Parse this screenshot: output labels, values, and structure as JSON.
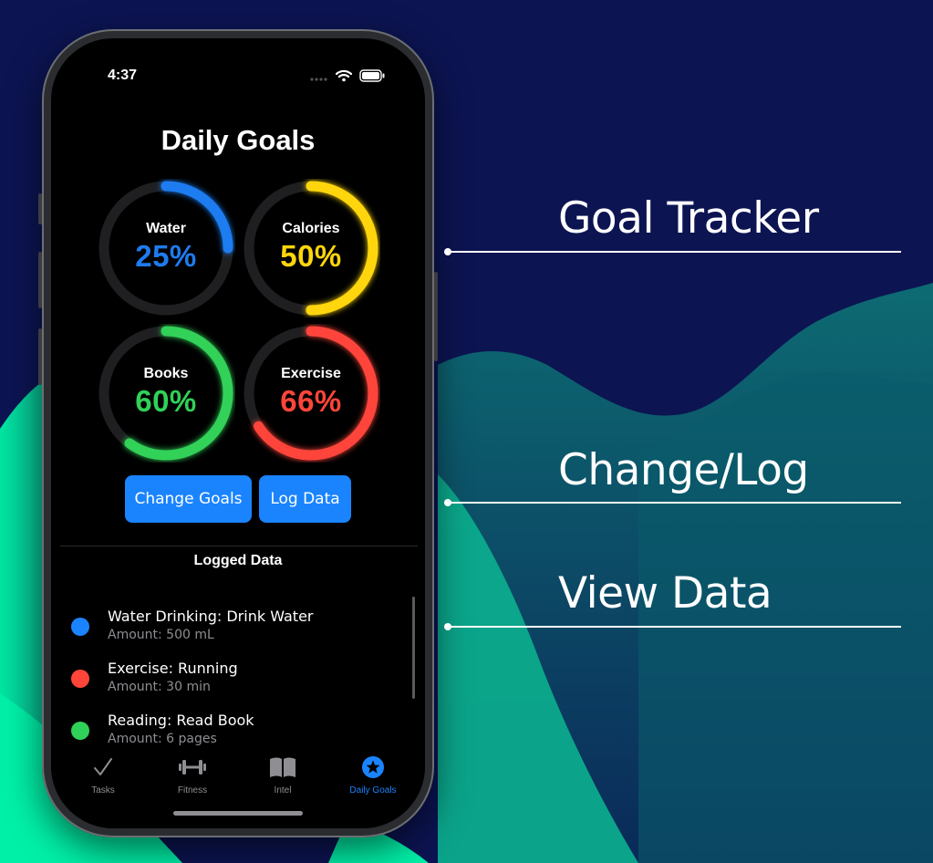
{
  "status": {
    "time": "4:37"
  },
  "title": "Daily Goals",
  "goals": [
    {
      "label": "Water",
      "percent_text": "25%",
      "progress": 0.25,
      "color": "#1e7bf0"
    },
    {
      "label": "Calories",
      "percent_text": "50%",
      "progress": 0.5,
      "color": "#ffd60a"
    },
    {
      "label": "Books",
      "percent_text": "60%",
      "progress": 0.6,
      "color": "#30d158"
    },
    {
      "label": "Exercise",
      "percent_text": "66%",
      "progress": 0.66,
      "color": "#ff453a"
    }
  ],
  "buttons": {
    "change_goals": "Change Goals",
    "log_data": "Log Data"
  },
  "logged": {
    "title": "Logged Data",
    "items": [
      {
        "title": "Water Drinking: Drink Water",
        "subtitle": "Amount: 500 mL",
        "color": "#1a84ff"
      },
      {
        "title": "Exercise: Running",
        "subtitle": "Amount: 30 min",
        "color": "#ff453a"
      },
      {
        "title": "Reading: Read Book",
        "subtitle": "Amount: 6 pages",
        "color": "#30d158"
      }
    ]
  },
  "tabs": [
    {
      "label": "Tasks",
      "icon": "checkmark-icon"
    },
    {
      "label": "Fitness",
      "icon": "dumbbell-icon"
    },
    {
      "label": "Intel",
      "icon": "book-icon"
    },
    {
      "label": "Daily Goals",
      "icon": "star-circle-icon",
      "active": true
    }
  ],
  "callouts": {
    "goal_tracker": "Goal Tracker",
    "change_log": "Change/Log",
    "view_data": "View Data"
  },
  "colors": {
    "accent": "#1a84ff",
    "background": "#0c1452",
    "wave": "#00e6a0"
  }
}
